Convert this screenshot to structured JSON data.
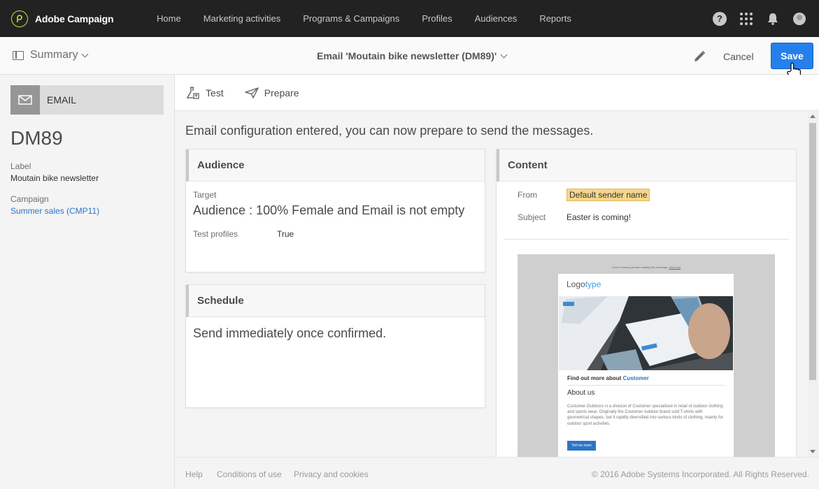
{
  "app": {
    "brand_name": "Adobe Campaign",
    "logo_icon": "adobe-campaign-logo-icon",
    "colors": {
      "topbar": "#222222",
      "accent": "#2680eb",
      "logo_ring": "#c6e337",
      "link": "#2d74c7"
    }
  },
  "topnav": {
    "items": [
      "Home",
      "Marketing activities",
      "Programs & Campaigns",
      "Profiles",
      "Audiences",
      "Reports"
    ],
    "help_glyph": "?",
    "icons": [
      "help-icon",
      "apps-icon",
      "bell-icon",
      "avatar"
    ]
  },
  "actionbar": {
    "summary_label": "Summary",
    "title": "Email 'Moutain bike newsletter (DM89)'",
    "cancel_label": "Cancel",
    "save_label": "Save"
  },
  "sidebar": {
    "channel_label": "EMAIL",
    "code": "DM89",
    "label_caption": "Label",
    "label_value": "Moutain bike newsletter",
    "campaign_caption": "Campaign",
    "campaign_value": "Summer sales (CMP11)"
  },
  "toolbar": {
    "test_label": "Test",
    "prepare_label": "Prepare"
  },
  "main": {
    "status_message": "Email configuration entered, you can now prepare to send the messages."
  },
  "audience_card": {
    "title": "Audience",
    "target_caption": "Target",
    "target_value": "Audience : 100% Female and Email is not empty",
    "test_profiles_caption": "Test profiles",
    "test_profiles_value": "True"
  },
  "schedule_card": {
    "title": "Schedule",
    "value": "Send immediately once confirmed."
  },
  "content_card": {
    "title": "Content",
    "from_caption": "From",
    "from_value": "Default sender name",
    "subject_caption": "Subject",
    "subject_value": "Easter is coming!"
  },
  "email_preview": {
    "note_text": "If you're having trouble reading this message,",
    "note_link": "click here",
    "logo_part1": "Logo",
    "logo_part2": "type",
    "findout_text": "Find out more about",
    "findout_brand": "Customer",
    "about_heading": "About us",
    "about_body": "Customer Outdoors is a division of Customer specialized in retail of outdoor clothing and sports wear. Originally the Customer outdoor brand sold T-shirts with geometrical shapes, but it rapidly diversified into various kinds of clothing, mainly for outdoor sport activities.",
    "button_label": "Tell me more"
  },
  "footer": {
    "help": "Help",
    "conditions": "Conditions of use",
    "privacy": "Privacy and cookies",
    "copyright": "© 2016 Adobe Systems Incorporated. All Rights Reserved."
  }
}
